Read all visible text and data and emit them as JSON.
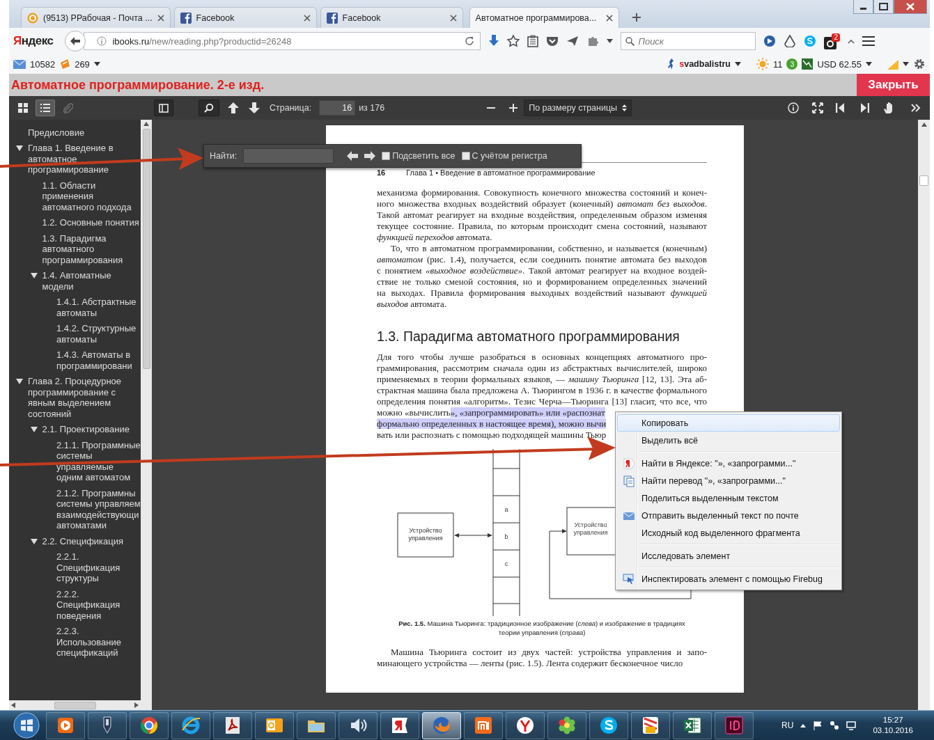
{
  "tabs": [
    {
      "title": "(9513) РРабочая - Почта ...",
      "kind": "mail",
      "selected": false
    },
    {
      "title": "Facebook",
      "kind": "facebook",
      "selected": false
    },
    {
      "title": "Facebook",
      "kind": "facebook",
      "selected": false
    },
    {
      "title": "Автоматное программирова...",
      "kind": "page",
      "selected": true
    }
  ],
  "navbar": {
    "logo": "Яндекс",
    "url_host": "ibooks.ru",
    "url_path": "/new/reading.php?productid=26248",
    "search_placeholder": "Поиск",
    "badge": "2"
  },
  "bookmarks": {
    "mail_count": "10582",
    "feed_count": "269",
    "site": "svadbalistru",
    "weather": "11",
    "notifications": "3",
    "currency": "USD 62.55"
  },
  "reader": {
    "title": "Автоматное программирование. 2-е изд.",
    "close": "Закрыть",
    "views": [
      {
        "kind": "thumbnails",
        "selected": false,
        "disabled": false
      },
      {
        "kind": "outline",
        "selected": true,
        "disabled": false
      },
      {
        "kind": "attachments",
        "selected": false,
        "disabled": true
      }
    ],
    "page_label": "Страница:",
    "page": "16",
    "page_total": "из 176",
    "zoom": "По размеру страницы"
  },
  "find": {
    "label": "Найти:",
    "options": [
      {
        "label": "Подсветить все",
        "checked": false
      },
      {
        "label": "С учётом регистра",
        "checked": false
      }
    ]
  },
  "outline": [
    {
      "title": "Предисловие"
    },
    {
      "title": "Глава 1. Введение в автоматное программирование",
      "expanded": true,
      "children": [
        {
          "title": "1.1. Области применения автоматного подхода"
        },
        {
          "title": "1.2. Основные понятия"
        },
        {
          "title": "1.3. Парадигма автоматного программирования"
        },
        {
          "title": "1.4. Автоматные модели",
          "expanded": true,
          "children": [
            {
              "title": "1.4.1. Абстрактные автоматы"
            },
            {
              "title": "1.4.2. Структурные автоматы"
            },
            {
              "title": "1.4.3. Автоматы в программировани"
            }
          ]
        }
      ]
    },
    {
      "title": "Глава 2. Процедурное программирование с явным выделением состояний",
      "expanded": true,
      "children": [
        {
          "title": "2.1. Проектирование",
          "expanded": true,
          "children": [
            {
              "title": "2.1.1. Программные системы управляемые одним автоматом"
            },
            {
              "title": "2.1.2. Программны системы управляем взаимодействующи автоматами"
            }
          ]
        },
        {
          "title": "2.2. Спецификация",
          "expanded": true,
          "children": [
            {
              "title": "2.2.1. Спецификация структуры"
            },
            {
              "title": "2.2.2. Спецификация поведения"
            },
            {
              "title": "2.2.3. Использование спецификаций"
            }
          ]
        }
      ]
    }
  ],
  "document": {
    "page_number": "16",
    "running_title": "Глава 1 • Введение в автоматное программирование",
    "blocks": [
      {
        "kind": "paragraph",
        "indent": false,
        "lines": [
          "механизма формирования. Совокупность конечного множества состояний и конеч-",
          "ного множества входных воздействий образует (конечный) *автомат без выходов*.",
          "Такой автомат реагирует на входные воздействия, определенным образом изменяя",
          "текущее состояние. Правила, по которым происходит смена состояний, называют",
          "*функцией переходов* автомата."
        ]
      },
      {
        "kind": "paragraph",
        "indent": true,
        "lines": [
          "То, что в автоматном программировании, собственно, и называется (конечным)",
          "*автоматом* (рис. 1.4), получается, если соединить понятие автомата без выходов",
          "с понятием *«выходное воздействие»*. Такой автомат реагирует на входное воздей-",
          "ствие не только сменой состояния, но и формированием определенных значений",
          "на выходах. Правила формирования выходных воздействий называют *функцией*",
          "*выходов* автомата."
        ]
      },
      {
        "kind": "heading",
        "text": "1.3. Парадигма автоматного программирования"
      },
      {
        "kind": "paragraph",
        "indent": false,
        "lines": [
          "Для того чтобы лучше разобраться в основных концепциях автоматного про-",
          "граммирования, рассмотрим сначала один из абстрактных вычислителей, широко",
          "применяемых в теории формальных языков, — *машину Тьюринга* [12, 13]. Эта аб-",
          "страктная машина была предложена А. Тьюрингом в 1936 г. в качестве формального",
          "определения понятия «алгоритм». Тезис Черча—Тьюринга [13] гласит, что все, что",
          {
            "parts": [
              {
                "text": "можно «вычислить",
                "selected": false
              },
              {
                "text": "», «запрограммировать» или «распознат",
                "selected": true
              }
            ]
          },
          {
            "parts": [
              {
                "text": "формально определенных в настоящее время), можно вычи",
                "selected": true
              }
            ]
          },
          "вать или распознать с помощью подходящей машины Тьюр"
        ]
      },
      {
        "kind": "figure",
        "left_unit": [
          "Устройство",
          "управления"
        ],
        "tape": [
          "a",
          "b",
          "c"
        ],
        "right_unit": [
          "Устройство",
          "управления"
        ]
      },
      {
        "kind": "caption",
        "lines": [
          "**Рис. 1.5.** Машина Тьюринга: традиционное изображение (*слева*) и изображение в традициях",
          "теории управления (*справа*)"
        ]
      },
      {
        "kind": "paragraph",
        "indent": true,
        "lines": [
          "Машина Тьюринга состоит из двух частей: устройства управления и запо-",
          "минающего устройства — ленты (рис. 1.5). Лента содержит бесконечное число"
        ]
      }
    ]
  },
  "context_menu": [
    [
      {
        "label": "Копировать",
        "kind": "plain",
        "selected": true
      },
      {
        "label": "Выделить всё",
        "kind": "plain",
        "selected": false
      }
    ],
    [
      {
        "label": "Найти в Яндексе: \"», «запрограмми...\"",
        "kind": "search",
        "selected": false
      },
      {
        "label": "Найти перевод \"», «запрограмми...\"",
        "kind": "translate",
        "selected": false
      },
      {
        "label": "Поделиться выделенным текстом",
        "kind": "plain",
        "selected": false
      },
      {
        "label": "Отправить выделенный текст по почте",
        "kind": "mail",
        "selected": false
      },
      {
        "label": "Исходный код выделенного фрагмента",
        "kind": "plain",
        "selected": false
      }
    ],
    [
      {
        "label": "Исследовать элемент",
        "kind": "plain",
        "selected": false
      }
    ],
    [
      {
        "label": "Инспектировать элемент с помощью Firebug",
        "kind": "inspect",
        "selected": false
      }
    ]
  ],
  "taskbar": {
    "language": "RU",
    "time": "15:27",
    "date": "03.10.2016",
    "apps": [
      {
        "kind": "media",
        "selected": false
      },
      {
        "kind": "pen",
        "selected": false
      },
      {
        "kind": "ring",
        "selected": false
      },
      {
        "kind": "ie",
        "selected": false
      },
      {
        "kind": "pdf",
        "selected": false
      },
      {
        "kind": "outlook",
        "selected": false
      },
      {
        "kind": "folder",
        "selected": false
      },
      {
        "kind": "speaker",
        "selected": false
      },
      {
        "kind": "yandex",
        "selected": false
      },
      {
        "kind": "firefox",
        "selected": true
      },
      {
        "kind": "mi",
        "selected": false
      },
      {
        "kind": "ybrowser",
        "selected": false
      },
      {
        "kind": "flower",
        "selected": false
      },
      {
        "kind": "skype",
        "selected": false
      },
      {
        "kind": "game",
        "selected": false
      },
      {
        "kind": "excel",
        "selected": false
      },
      {
        "kind": "indesign",
        "selected": false
      }
    ]
  }
}
